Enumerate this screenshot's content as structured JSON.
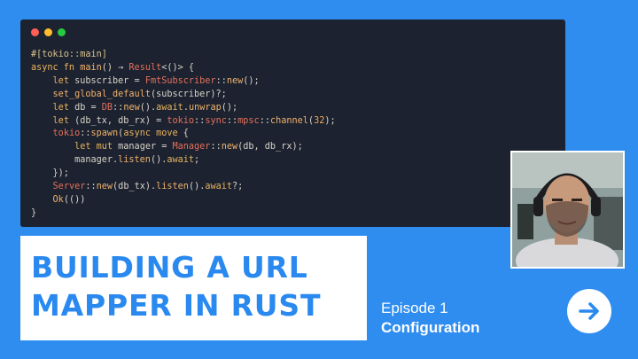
{
  "code_window": {
    "dots": [
      {
        "name": "close-dot",
        "color": "#ff5f56"
      },
      {
        "name": "minimize-dot",
        "color": "#ffbd2e"
      },
      {
        "name": "maximize-dot",
        "color": "#27c93f"
      }
    ],
    "lines": [
      [
        [
          "attr",
          "#[tokio::main]"
        ]
      ],
      [
        [
          "kw",
          "async fn "
        ],
        [
          "fn",
          "main"
        ],
        [
          "op",
          "() → "
        ],
        [
          "ty",
          "Result"
        ],
        [
          "op",
          "<()> {"
        ]
      ],
      [
        [
          "op",
          "    "
        ],
        [
          "kw",
          "let "
        ],
        [
          "op",
          "subscriber = "
        ],
        [
          "ty",
          "FmtSubscriber"
        ],
        [
          "op",
          "::"
        ],
        [
          "fn",
          "new"
        ],
        [
          "op",
          "();"
        ]
      ],
      [
        [
          "op",
          "    "
        ],
        [
          "fn",
          "set_global_default"
        ],
        [
          "op",
          "(subscriber)?;"
        ]
      ],
      [
        [
          "op",
          "    "
        ],
        [
          "kw",
          "let "
        ],
        [
          "op",
          "db = "
        ],
        [
          "ty",
          "DB"
        ],
        [
          "op",
          "::"
        ],
        [
          "fn",
          "new"
        ],
        [
          "op",
          "()."
        ],
        [
          "kw",
          "await"
        ],
        [
          "op",
          "."
        ],
        [
          "fn",
          "unwrap"
        ],
        [
          "op",
          "();"
        ]
      ],
      [
        [
          "op",
          "    "
        ],
        [
          "kw",
          "let "
        ],
        [
          "op",
          "(db_tx, db_rx) = "
        ],
        [
          "ty",
          "tokio"
        ],
        [
          "op",
          "::"
        ],
        [
          "ty",
          "sync"
        ],
        [
          "op",
          "::"
        ],
        [
          "ty",
          "mpsc"
        ],
        [
          "op",
          "::"
        ],
        [
          "fn",
          "channel"
        ],
        [
          "op",
          "("
        ],
        [
          "num",
          "32"
        ],
        [
          "op",
          ");"
        ]
      ],
      [
        [
          "op",
          "    "
        ],
        [
          "ty",
          "tokio"
        ],
        [
          "op",
          "::"
        ],
        [
          "fn",
          "spawn"
        ],
        [
          "op",
          "("
        ],
        [
          "kw",
          "async move"
        ],
        [
          "op",
          " {"
        ]
      ],
      [
        [
          "op",
          "        "
        ],
        [
          "kw",
          "let mut "
        ],
        [
          "op",
          "manager = "
        ],
        [
          "ty",
          "Manager"
        ],
        [
          "op",
          "::"
        ],
        [
          "fn",
          "new"
        ],
        [
          "op",
          "(db, db_rx);"
        ]
      ],
      [
        [
          "op",
          "        manager."
        ],
        [
          "fn",
          "listen"
        ],
        [
          "op",
          "()."
        ],
        [
          "kw",
          "await"
        ],
        [
          "op",
          ";"
        ]
      ],
      [
        [
          "op",
          "    });"
        ]
      ],
      [
        [
          "op",
          "    "
        ],
        [
          "ty",
          "Server"
        ],
        [
          "op",
          "::"
        ],
        [
          "fn",
          "new"
        ],
        [
          "op",
          "(db_tx)."
        ],
        [
          "fn",
          "listen"
        ],
        [
          "op",
          "()."
        ],
        [
          "kw",
          "await"
        ],
        [
          "op",
          "?;"
        ]
      ],
      [
        [
          "op",
          "    "
        ],
        [
          "fn",
          "Ok"
        ],
        [
          "op",
          "(())"
        ]
      ],
      [
        [
          "op",
          "}"
        ]
      ]
    ]
  },
  "title": {
    "line1": "BUILDING A URL",
    "line2": "MAPPER IN RUST"
  },
  "episode": {
    "label": "Episode 1",
    "subtitle": "Configuration"
  },
  "next_button": {
    "icon": "arrow-right-icon"
  },
  "colors": {
    "background": "#2f8df0",
    "accent": "#2a89ef",
    "code_bg": "#1c2230"
  }
}
